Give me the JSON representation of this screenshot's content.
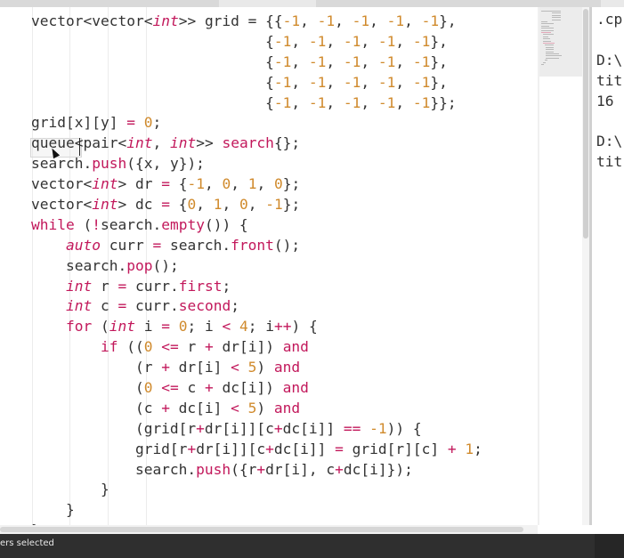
{
  "editor": {
    "lines": [
      [
        [
          "t",
          "vector<vector<"
        ],
        [
          "ty",
          "int"
        ],
        [
          "t",
          ">> grid = {{"
        ],
        [
          "num",
          "-1"
        ],
        [
          "t",
          ", "
        ],
        [
          "num",
          "-1"
        ],
        [
          "t",
          ", "
        ],
        [
          "num",
          "-1"
        ],
        [
          "t",
          ", "
        ],
        [
          "num",
          "-1"
        ],
        [
          "t",
          ", "
        ],
        [
          "num",
          "-1"
        ],
        [
          "t",
          "},"
        ]
      ],
      [
        [
          "t",
          "                           {"
        ],
        [
          "num",
          "-1"
        ],
        [
          "t",
          ", "
        ],
        [
          "num",
          "-1"
        ],
        [
          "t",
          ", "
        ],
        [
          "num",
          "-1"
        ],
        [
          "t",
          ", "
        ],
        [
          "num",
          "-1"
        ],
        [
          "t",
          ", "
        ],
        [
          "num",
          "-1"
        ],
        [
          "t",
          "},"
        ]
      ],
      [
        [
          "t",
          "                           {"
        ],
        [
          "num",
          "-1"
        ],
        [
          "t",
          ", "
        ],
        [
          "num",
          "-1"
        ],
        [
          "t",
          ", "
        ],
        [
          "num",
          "-1"
        ],
        [
          "t",
          ", "
        ],
        [
          "num",
          "-1"
        ],
        [
          "t",
          ", "
        ],
        [
          "num",
          "-1"
        ],
        [
          "t",
          "},"
        ]
      ],
      [
        [
          "t",
          "                           {"
        ],
        [
          "num",
          "-1"
        ],
        [
          "t",
          ", "
        ],
        [
          "num",
          "-1"
        ],
        [
          "t",
          ", "
        ],
        [
          "num",
          "-1"
        ],
        [
          "t",
          ", "
        ],
        [
          "num",
          "-1"
        ],
        [
          "t",
          ", "
        ],
        [
          "num",
          "-1"
        ],
        [
          "t",
          "},"
        ]
      ],
      [
        [
          "t",
          "                           {"
        ],
        [
          "num",
          "-1"
        ],
        [
          "t",
          ", "
        ],
        [
          "num",
          "-1"
        ],
        [
          "t",
          ", "
        ],
        [
          "num",
          "-1"
        ],
        [
          "t",
          ", "
        ],
        [
          "num",
          "-1"
        ],
        [
          "t",
          ", "
        ],
        [
          "num",
          "-1"
        ],
        [
          "t",
          "}};"
        ]
      ],
      [
        [
          "t",
          "grid[x][y] "
        ],
        [
          "op",
          "="
        ],
        [
          "t",
          " "
        ],
        [
          "num",
          "0"
        ],
        [
          "t",
          ";"
        ]
      ],
      [
        [
          "t",
          "queue<pair<"
        ],
        [
          "ty",
          "int"
        ],
        [
          "t",
          ", "
        ],
        [
          "ty",
          "int"
        ],
        [
          "t",
          ">> "
        ],
        [
          "fn",
          "search"
        ],
        [
          "t",
          "{};"
        ]
      ],
      [
        [
          "t",
          "search."
        ],
        [
          "fn",
          "push"
        ],
        [
          "t",
          "({x, y});"
        ]
      ],
      [
        [
          "t",
          "vector<"
        ],
        [
          "ty",
          "int"
        ],
        [
          "t",
          "> dr "
        ],
        [
          "op",
          "="
        ],
        [
          "t",
          " {"
        ],
        [
          "num",
          "-1"
        ],
        [
          "t",
          ", "
        ],
        [
          "num",
          "0"
        ],
        [
          "t",
          ", "
        ],
        [
          "num",
          "1"
        ],
        [
          "t",
          ", "
        ],
        [
          "num",
          "0"
        ],
        [
          "t",
          "};"
        ]
      ],
      [
        [
          "t",
          "vector<"
        ],
        [
          "ty",
          "int"
        ],
        [
          "t",
          "> dc "
        ],
        [
          "op",
          "="
        ],
        [
          "t",
          " {"
        ],
        [
          "num",
          "0"
        ],
        [
          "t",
          ", "
        ],
        [
          "num",
          "1"
        ],
        [
          "t",
          ", "
        ],
        [
          "num",
          "0"
        ],
        [
          "t",
          ", "
        ],
        [
          "num",
          "-1"
        ],
        [
          "t",
          "};"
        ]
      ],
      [
        [
          "kw",
          "while"
        ],
        [
          "t",
          " ("
        ],
        [
          "op",
          "!"
        ],
        [
          "t",
          "search."
        ],
        [
          "fn",
          "empty"
        ],
        [
          "t",
          "()) {"
        ]
      ],
      [
        [
          "t",
          "    "
        ],
        [
          "ty",
          "auto"
        ],
        [
          "t",
          " curr "
        ],
        [
          "op",
          "="
        ],
        [
          "t",
          " search."
        ],
        [
          "fn",
          "front"
        ],
        [
          "t",
          "();"
        ]
      ],
      [
        [
          "t",
          "    search."
        ],
        [
          "fn",
          "pop"
        ],
        [
          "t",
          "();"
        ]
      ],
      [
        [
          "t",
          "    "
        ],
        [
          "ty",
          "int"
        ],
        [
          "t",
          " r "
        ],
        [
          "op",
          "="
        ],
        [
          "t",
          " curr."
        ],
        [
          "fn",
          "first"
        ],
        [
          "t",
          ";"
        ]
      ],
      [
        [
          "t",
          "    "
        ],
        [
          "ty",
          "int"
        ],
        [
          "t",
          " c "
        ],
        [
          "op",
          "="
        ],
        [
          "t",
          " curr."
        ],
        [
          "fn",
          "second"
        ],
        [
          "t",
          ";"
        ]
      ],
      [
        [
          "t",
          "    "
        ],
        [
          "kw",
          "for"
        ],
        [
          "t",
          " ("
        ],
        [
          "ty",
          "int"
        ],
        [
          "t",
          " i "
        ],
        [
          "op",
          "="
        ],
        [
          "t",
          " "
        ],
        [
          "num",
          "0"
        ],
        [
          "t",
          "; i "
        ],
        [
          "op",
          "<"
        ],
        [
          "t",
          " "
        ],
        [
          "num",
          "4"
        ],
        [
          "t",
          "; i"
        ],
        [
          "op",
          "++"
        ],
        [
          "t",
          ") {"
        ]
      ],
      [
        [
          "t",
          "        "
        ],
        [
          "kw",
          "if"
        ],
        [
          "t",
          " (("
        ],
        [
          "num",
          "0"
        ],
        [
          "t",
          " "
        ],
        [
          "op",
          "<="
        ],
        [
          "t",
          " r "
        ],
        [
          "op",
          "+"
        ],
        [
          "t",
          " dr[i]) "
        ],
        [
          "kw",
          "and"
        ]
      ],
      [
        [
          "t",
          "            (r "
        ],
        [
          "op",
          "+"
        ],
        [
          "t",
          " dr[i] "
        ],
        [
          "op",
          "<"
        ],
        [
          "t",
          " "
        ],
        [
          "num",
          "5"
        ],
        [
          "t",
          ") "
        ],
        [
          "kw",
          "and"
        ]
      ],
      [
        [
          "t",
          "            ("
        ],
        [
          "num",
          "0"
        ],
        [
          "t",
          " "
        ],
        [
          "op",
          "<="
        ],
        [
          "t",
          " c "
        ],
        [
          "op",
          "+"
        ],
        [
          "t",
          " dc[i]) "
        ],
        [
          "kw",
          "and"
        ]
      ],
      [
        [
          "t",
          "            (c "
        ],
        [
          "op",
          "+"
        ],
        [
          "t",
          " dc[i] "
        ],
        [
          "op",
          "<"
        ],
        [
          "t",
          " "
        ],
        [
          "num",
          "5"
        ],
        [
          "t",
          ") "
        ],
        [
          "kw",
          "and"
        ]
      ],
      [
        [
          "t",
          "            (grid[r"
        ],
        [
          "op",
          "+"
        ],
        [
          "t",
          "dr[i]][c"
        ],
        [
          "op",
          "+"
        ],
        [
          "t",
          "dc[i]] "
        ],
        [
          "op",
          "=="
        ],
        [
          "t",
          " "
        ],
        [
          "num",
          "-1"
        ],
        [
          "t",
          ")) {"
        ]
      ],
      [
        [
          "t",
          "            grid[r"
        ],
        [
          "op",
          "+"
        ],
        [
          "t",
          "dr[i]][c"
        ],
        [
          "op",
          "+"
        ],
        [
          "t",
          "dc[i]] "
        ],
        [
          "op",
          "="
        ],
        [
          "t",
          " grid[r][c] "
        ],
        [
          "op",
          "+"
        ],
        [
          "t",
          " "
        ],
        [
          "num",
          "1"
        ],
        [
          "t",
          ";"
        ]
      ],
      [
        [
          "t",
          "            search."
        ],
        [
          "fn",
          "push"
        ],
        [
          "t",
          "({r"
        ],
        [
          "op",
          "+"
        ],
        [
          "t",
          "dr[i], c"
        ],
        [
          "op",
          "+"
        ],
        [
          "t",
          "dc[i]});"
        ]
      ],
      [
        [
          "t",
          "        }"
        ]
      ],
      [
        [
          "t",
          "    }"
        ]
      ],
      [
        [
          "t",
          "}"
        ]
      ]
    ]
  },
  "output_panel": {
    "lines": [
      ".cp",
      "",
      "D:\\",
      "tit",
      "16",
      "",
      "D:\\",
      "tit"
    ]
  },
  "status_bar": {
    "text": "ers selected"
  },
  "colors": {
    "keyword": "#c2185b",
    "number": "#d08a2c",
    "text": "#333333",
    "status_bg": "#2f2f2f"
  }
}
